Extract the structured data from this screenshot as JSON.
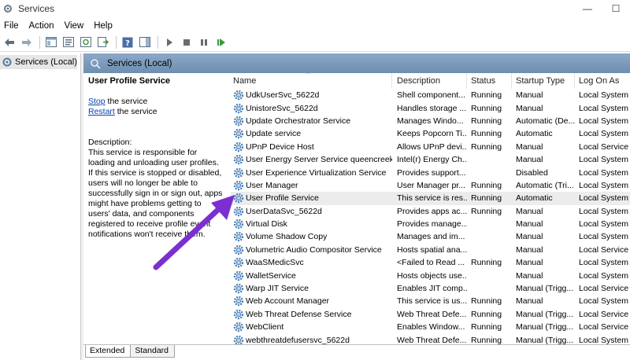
{
  "window": {
    "title": "Services"
  },
  "window_buttons": {
    "minimize": "—",
    "maximize": "☐"
  },
  "menu": [
    "File",
    "Action",
    "View",
    "Help"
  ],
  "tree": {
    "item": "Services (Local)"
  },
  "panel": {
    "header": "Services (Local)"
  },
  "selected": {
    "title": "User Profile Service",
    "stop_link": "Stop",
    "stop_rest": " the service",
    "restart_link": "Restart",
    "restart_rest": " the service",
    "desc_label": "Description:",
    "desc_text": "This service is responsible for loading and unloading user profiles. If this service is stopped or disabled, users will no longer be able to successfully sign in or sign out, apps might have problems getting to users' data, and components registered to receive profile event notifications won't receive them."
  },
  "columns": {
    "name": "Name",
    "description": "Description",
    "status": "Status",
    "startup": "Startup Type",
    "logon": "Log On As"
  },
  "rows": [
    {
      "name": "UdkUserSvc_5622d",
      "description": "Shell component...",
      "status": "Running",
      "startup": "Manual",
      "logon": "Local System"
    },
    {
      "name": "UnistoreSvc_5622d",
      "description": "Handles storage ...",
      "status": "Running",
      "startup": "Manual",
      "logon": "Local System"
    },
    {
      "name": "Update Orchestrator Service",
      "description": "Manages Windo...",
      "status": "Running",
      "startup": "Automatic (De...",
      "logon": "Local System"
    },
    {
      "name": "Update service",
      "description": "Keeps Popcorn Ti...",
      "status": "Running",
      "startup": "Automatic",
      "logon": "Local System"
    },
    {
      "name": "UPnP Device Host",
      "description": "Allows UPnP devi...",
      "status": "Running",
      "startup": "Manual",
      "logon": "Local Service"
    },
    {
      "name": "User Energy Server Service queencreek",
      "description": "Intel(r) Energy Ch...",
      "status": "",
      "startup": "Manual",
      "logon": "Local System"
    },
    {
      "name": "User Experience Virtualization Service",
      "description": "Provides support...",
      "status": "",
      "startup": "Disabled",
      "logon": "Local System"
    },
    {
      "name": "User Manager",
      "description": "User Manager pr...",
      "status": "Running",
      "startup": "Automatic (Tri...",
      "logon": "Local System"
    },
    {
      "name": "User Profile Service",
      "description": "This service is res...",
      "status": "Running",
      "startup": "Automatic",
      "logon": "Local System"
    },
    {
      "name": "UserDataSvc_5622d",
      "description": "Provides apps ac...",
      "status": "Running",
      "startup": "Manual",
      "logon": "Local System"
    },
    {
      "name": "Virtual Disk",
      "description": "Provides manage...",
      "status": "",
      "startup": "Manual",
      "logon": "Local System"
    },
    {
      "name": "Volume Shadow Copy",
      "description": "Manages and im...",
      "status": "",
      "startup": "Manual",
      "logon": "Local System"
    },
    {
      "name": "Volumetric Audio Compositor Service",
      "description": "Hosts spatial ana...",
      "status": "",
      "startup": "Manual",
      "logon": "Local Service"
    },
    {
      "name": "WaaSMedicSvc",
      "description": "<Failed to Read ...",
      "status": "Running",
      "startup": "Manual",
      "logon": "Local System"
    },
    {
      "name": "WalletService",
      "description": "Hosts objects use...",
      "status": "",
      "startup": "Manual",
      "logon": "Local System"
    },
    {
      "name": "Warp JIT Service",
      "description": "Enables JIT comp...",
      "status": "",
      "startup": "Manual (Trigg...",
      "logon": "Local Service"
    },
    {
      "name": "Web Account Manager",
      "description": "This service is us...",
      "status": "Running",
      "startup": "Manual",
      "logon": "Local System"
    },
    {
      "name": "Web Threat Defense Service",
      "description": "Web Threat Defe...",
      "status": "Running",
      "startup": "Manual (Trigg...",
      "logon": "Local Service"
    },
    {
      "name": "WebClient",
      "description": "Enables Window...",
      "status": "Running",
      "startup": "Manual (Trigg...",
      "logon": "Local Service"
    },
    {
      "name": "webthreatdefusersvc_5622d",
      "description": "Web Threat Defe...",
      "status": "Running",
      "startup": "Manual (Trigg...",
      "logon": "Local System"
    }
  ],
  "tabs": [
    "Extended",
    "Standard"
  ],
  "colors": {
    "header_blue": "#7f9dbd",
    "link": "#0645ad",
    "arrow": "#7b2fd1",
    "gear": "#4a7fb5"
  }
}
